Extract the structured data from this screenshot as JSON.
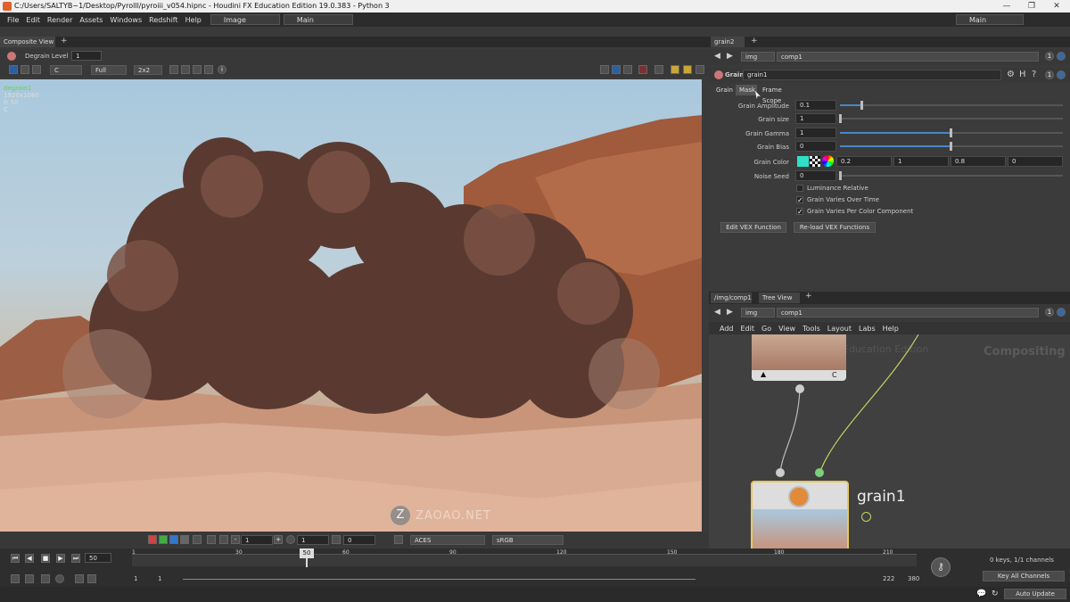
{
  "window": {
    "title": "C:/Users/SALTYB~1/Desktop/Pyrolll/pyroiii_v054.hipnc - Houdini FX Education Edition 19.0.383 - Python 3",
    "controls": [
      "—",
      "❐",
      "✕"
    ]
  },
  "menubar": {
    "items": [
      "File",
      "Edit",
      "Render",
      "Assets",
      "Windows",
      "Redshift",
      "Help"
    ],
    "desktop1": "Image",
    "desktop2": "Main",
    "right_desktop": "Main"
  },
  "left_pane": {
    "tab": "Composite View",
    "degrain_label": "Degrain Level",
    "degrain_value": "1",
    "toolbar": {
      "channel": "C",
      "resolution": "Full",
      "subsample": "2x2"
    },
    "viewer_info": {
      "node": "degrain1",
      "res": "1920x1080",
      "frame": "fr 50",
      "plane": "C"
    },
    "bottom": {
      "field1": "1",
      "field2": "1",
      "field3": "0",
      "colorspace": "ACES",
      "display": "sRGB"
    }
  },
  "params": {
    "tab": "grain2",
    "path_img": "img",
    "path_comp": "comp1",
    "node_type": "Grain",
    "node_name": "grain1",
    "subtabs": [
      "Grain",
      "Mask",
      "Frame Scope"
    ],
    "rows": [
      {
        "label": "Grain Amplitude",
        "value": "0.1",
        "fill": 0.15
      },
      {
        "label": "Grain size",
        "value": "1",
        "fill": 0.0
      },
      {
        "label": "Grain Gamma",
        "value": "1",
        "fill": 0.5
      },
      {
        "label": "Grain Bias",
        "value": "0",
        "fill": 0.5
      },
      {
        "label": "Noise Seed",
        "value": "0",
        "fill": 0.0
      }
    ],
    "grain_color": {
      "label": "Grain Color",
      "v1": "0.2",
      "v2": "1",
      "v3": "0.8",
      "v4": "0"
    },
    "checks": [
      {
        "label": "Luminance Relative",
        "checked": false
      },
      {
        "label": "Grain Varies Over Time",
        "checked": true
      },
      {
        "label": "Grain Varies Per Color Component",
        "checked": true
      }
    ],
    "buttons": [
      "Edit VEX Function",
      "Re-load VEX Functions"
    ]
  },
  "network": {
    "tab1": "/img/comp1",
    "tab2": "Tree View",
    "path_img": "img",
    "path_comp": "comp1",
    "menu": [
      "Add",
      "Edit",
      "Go",
      "View",
      "Tools",
      "Layout",
      "Labs",
      "Help"
    ],
    "watermark": "Education Edition",
    "context_label": "Compositing",
    "node1_flag": "C",
    "node2_name": "grain1"
  },
  "timeline": {
    "frame": "50",
    "current_marker": "50",
    "ticks": [
      "1",
      "30",
      "60",
      "90",
      "120",
      "150",
      "180",
      "210"
    ],
    "start": "1",
    "start2": "1",
    "end": "222",
    "end2": "380",
    "keys_info": "0 keys, 1/1 channels",
    "key_all": "Key All Channels"
  },
  "status": {
    "auto_update": "Auto Update"
  },
  "watermark_overlay": "ZAOAO.NET"
}
